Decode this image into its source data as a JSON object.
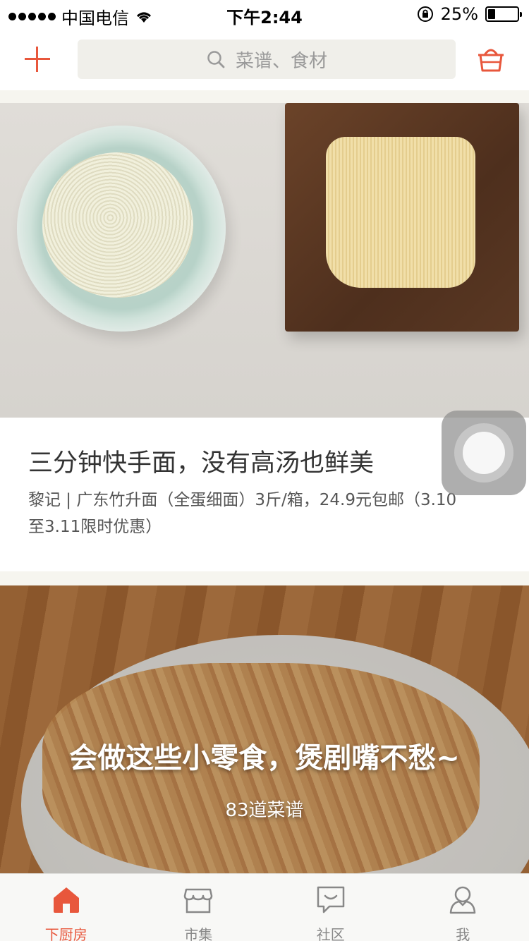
{
  "status_bar": {
    "carrier": "中国电信",
    "time": "下午2:44",
    "battery": "25%",
    "battery_level": 0.25
  },
  "header": {
    "add_icon": "plus-icon",
    "search_placeholder": "菜谱、食材",
    "search_icon": "search-icon",
    "basket_icon": "basket-icon"
  },
  "feed": {
    "card1": {
      "title": "三分钟快手面，没有高汤也鲜美",
      "description": "黎记 | 广东竹升面（全蛋细面）3斤/箱，24.9元包邮（3.10至3.11限时优惠）"
    },
    "card2": {
      "title": "会做这些小零食，煲剧嘴不愁~",
      "count": "83道菜谱"
    }
  },
  "floating_button": "assistive-touch-icon",
  "tabbar": {
    "tabs": [
      {
        "label": "下厨房",
        "icon": "home-icon",
        "active": true
      },
      {
        "label": "市集",
        "icon": "market-icon",
        "active": false
      },
      {
        "label": "社区",
        "icon": "chat-icon",
        "active": false
      },
      {
        "label": "我",
        "icon": "user-icon",
        "active": false
      }
    ]
  },
  "colors": {
    "accent": "#e8573c",
    "search_bg": "#f0efea",
    "band": "#f6f5ef"
  }
}
